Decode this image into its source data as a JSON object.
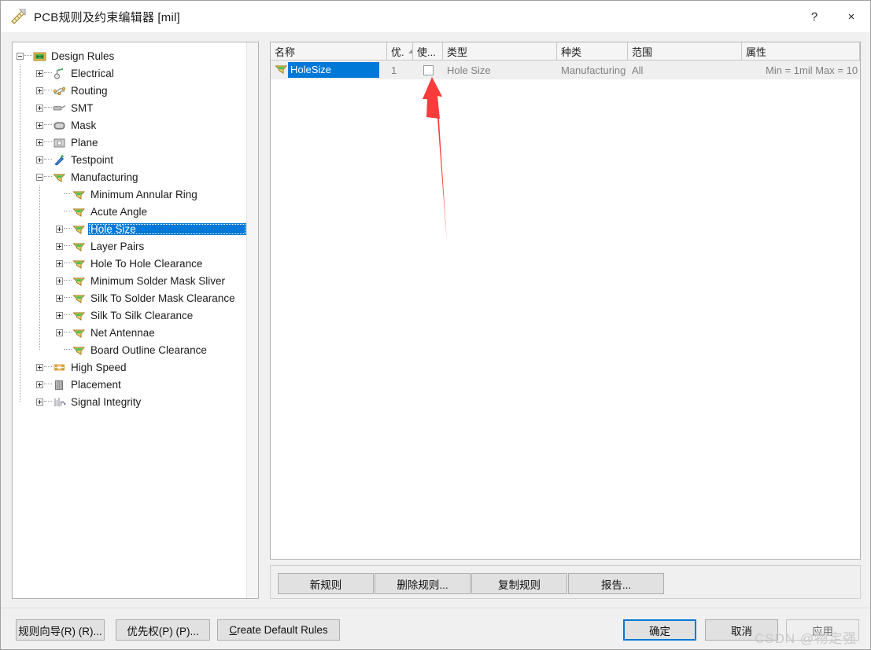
{
  "window": {
    "title": "PCB规则及约束编辑器 [mil]",
    "icon": "ruler-triangle-icon",
    "help_label": "?",
    "close_label": "×"
  },
  "tree": {
    "nodes": [
      {
        "label": "Design Rules",
        "depth": 0,
        "expander": "minus",
        "icon": "design-rules-folder-icon",
        "selected": false
      },
      {
        "label": "Electrical",
        "depth": 1,
        "expander": "plus",
        "icon": "electrical-icon",
        "selected": false
      },
      {
        "label": "Routing",
        "depth": 1,
        "expander": "plus",
        "icon": "routing-icon",
        "selected": false
      },
      {
        "label": "SMT",
        "depth": 1,
        "expander": "plus",
        "icon": "smt-icon",
        "selected": false
      },
      {
        "label": "Mask",
        "depth": 1,
        "expander": "plus",
        "icon": "mask-icon",
        "selected": false
      },
      {
        "label": "Plane",
        "depth": 1,
        "expander": "plus",
        "icon": "plane-icon",
        "selected": false
      },
      {
        "label": "Testpoint",
        "depth": 1,
        "expander": "plus",
        "icon": "testpoint-icon",
        "selected": false
      },
      {
        "label": "Manufacturing",
        "depth": 1,
        "expander": "minus",
        "icon": "manufacturing-icon",
        "selected": false
      },
      {
        "label": "Minimum Annular Ring",
        "depth": 2,
        "expander": "none",
        "icon": "rule-flag-icon",
        "selected": false
      },
      {
        "label": "Acute Angle",
        "depth": 2,
        "expander": "none",
        "icon": "rule-flag-icon",
        "selected": false
      },
      {
        "label": "Hole Size",
        "depth": 2,
        "expander": "plus",
        "icon": "rule-flag-icon",
        "selected": true
      },
      {
        "label": "Layer Pairs",
        "depth": 2,
        "expander": "plus",
        "icon": "rule-flag-icon",
        "selected": false
      },
      {
        "label": "Hole To Hole Clearance",
        "depth": 2,
        "expander": "plus",
        "icon": "rule-flag-icon",
        "selected": false
      },
      {
        "label": "Minimum Solder Mask Sliver",
        "depth": 2,
        "expander": "plus",
        "icon": "rule-flag-icon",
        "selected": false
      },
      {
        "label": "Silk To Solder Mask Clearance",
        "depth": 2,
        "expander": "plus",
        "icon": "rule-flag-icon",
        "selected": false
      },
      {
        "label": "Silk To Silk Clearance",
        "depth": 2,
        "expander": "plus",
        "icon": "rule-flag-icon",
        "selected": false
      },
      {
        "label": "Net Antennae",
        "depth": 2,
        "expander": "plus",
        "icon": "rule-flag-icon",
        "selected": false
      },
      {
        "label": "Board Outline Clearance",
        "depth": 2,
        "expander": "none",
        "icon": "rule-flag-icon",
        "selected": false
      },
      {
        "label": "High Speed",
        "depth": 1,
        "expander": "plus",
        "icon": "high-speed-icon",
        "selected": false
      },
      {
        "label": "Placement",
        "depth": 1,
        "expander": "plus",
        "icon": "placement-icon",
        "selected": false
      },
      {
        "label": "Signal Integrity",
        "depth": 1,
        "expander": "plus",
        "icon": "signal-integrity-icon",
        "selected": false
      }
    ]
  },
  "list": {
    "columns": [
      {
        "label": "名称",
        "sorted": false
      },
      {
        "label": "优.",
        "sorted": true
      },
      {
        "label": "使...",
        "sorted": false
      },
      {
        "label": "类型",
        "sorted": false
      },
      {
        "label": "种类",
        "sorted": false
      },
      {
        "label": "范围",
        "sorted": false
      },
      {
        "label": "属性",
        "sorted": false
      }
    ],
    "rows": [
      {
        "name": "HoleSize",
        "priority": "1",
        "enabled": false,
        "type": "Hole Size",
        "category": "Manufacturing",
        "scope": "All",
        "attributes": "Min = 1mil   Max = 10"
      }
    ]
  },
  "rule_buttons": [
    {
      "label": "新规则"
    },
    {
      "label": "删除规则..."
    },
    {
      "label": "复制规则"
    },
    {
      "label": "报告..."
    }
  ],
  "bottom_buttons": {
    "left": [
      {
        "label": "规则向导(R) (R)...",
        "accel": "R"
      },
      {
        "label": "优先权(P) (P)...",
        "accel": "P"
      }
    ],
    "create_default": {
      "accel": "C",
      "rest": "reate Default Rules"
    },
    "right": [
      {
        "label": "确定",
        "style": "default"
      },
      {
        "label": "取消",
        "style": "normal"
      },
      {
        "label": "应用",
        "style": "disabled"
      }
    ]
  },
  "annotation": {
    "arrow": "red-up-arrow",
    "color": "#fa3c3c",
    "points_to": "enabled-checkbox"
  },
  "watermark": {
    "text": "CSDN @物定强"
  },
  "colors": {
    "accent": "#0078d7",
    "annotation": "#fa3c3c",
    "window_bg": "#f0f0f0",
    "panel_bg": "#ffffff",
    "row_bg": "#efefef"
  }
}
